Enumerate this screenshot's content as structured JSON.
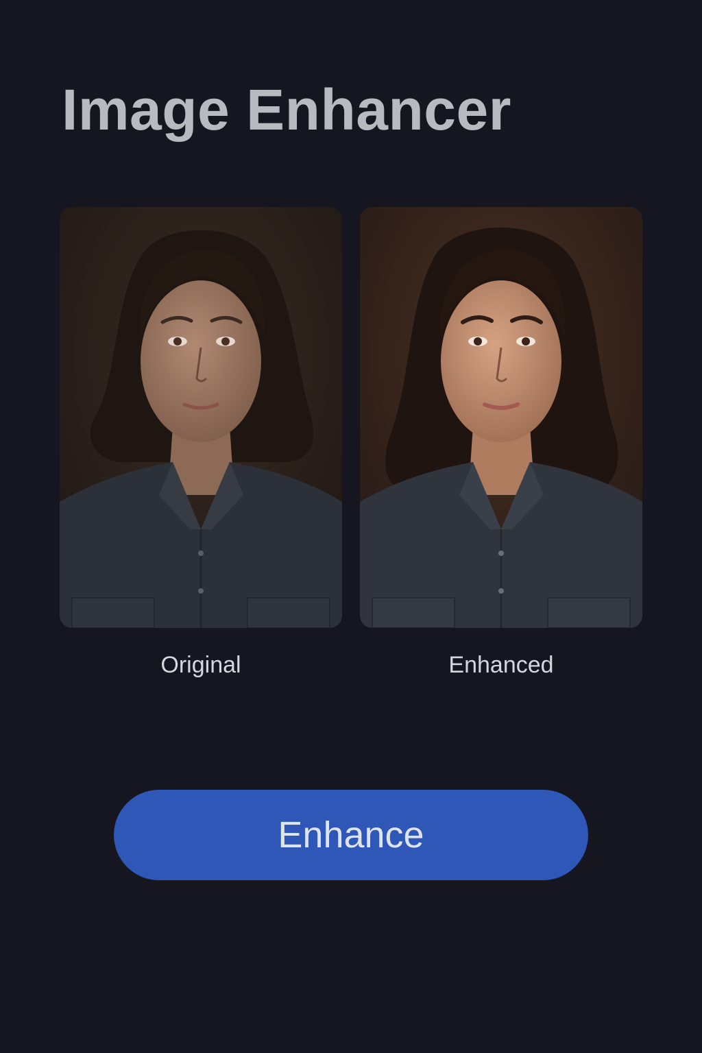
{
  "app": {
    "title": "Image Enhancer"
  },
  "comparison": {
    "original": {
      "caption": "Original",
      "image_description": "portrait-photo"
    },
    "enhanced": {
      "caption": "Enhanced",
      "image_description": "portrait-photo"
    }
  },
  "actions": {
    "enhance_label": "Enhance"
  },
  "colors": {
    "background": "#151620",
    "accent": "#2e57b8",
    "title": "#b9bac0",
    "caption": "#d6d7dc"
  }
}
